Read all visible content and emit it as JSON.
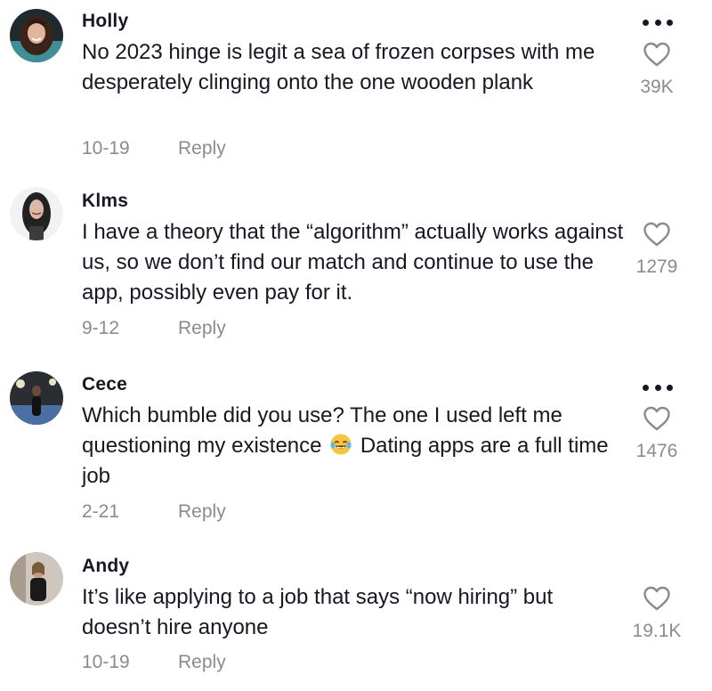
{
  "comments": [
    {
      "username": "Holly",
      "text": "No 2023 hinge is legit a sea of frozen corpses with me desperately clinging onto the one wooden plank",
      "date": "10-19",
      "reply_label": "Reply",
      "likes": "39K",
      "avatar_icon": "profile-photo",
      "has_more_menu": true
    },
    {
      "username": "Klms",
      "text": "I have a theory that the “algorithm” actually works against us, so we don’t find our match and continue to use the app, possibly even pay for it.",
      "date": "9-12",
      "reply_label": "Reply",
      "likes": "1279",
      "avatar_icon": "profile-photo",
      "has_more_menu": false
    },
    {
      "username": "Cece",
      "text_before_emoji": "Which bumble did you use? The one I used left me questioning my existence",
      "emoji": "face-with-tears-of-joy",
      "text_after_emoji": "Dating apps are a full time job",
      "date": "2-21",
      "reply_label": "Reply",
      "likes": "1476",
      "avatar_icon": "profile-photo",
      "has_more_menu": true
    },
    {
      "username": "Andy",
      "text": "It’s like applying to a job that says “now hiring” but doesn’t hire anyone",
      "date": "10-19",
      "reply_label": "Reply",
      "likes": "19.1K",
      "avatar_icon": "profile-photo",
      "has_more_menu": false
    }
  ],
  "colors": {
    "primary_text": "#161823",
    "secondary_text": "#8a8b91",
    "background": "#ffffff"
  }
}
